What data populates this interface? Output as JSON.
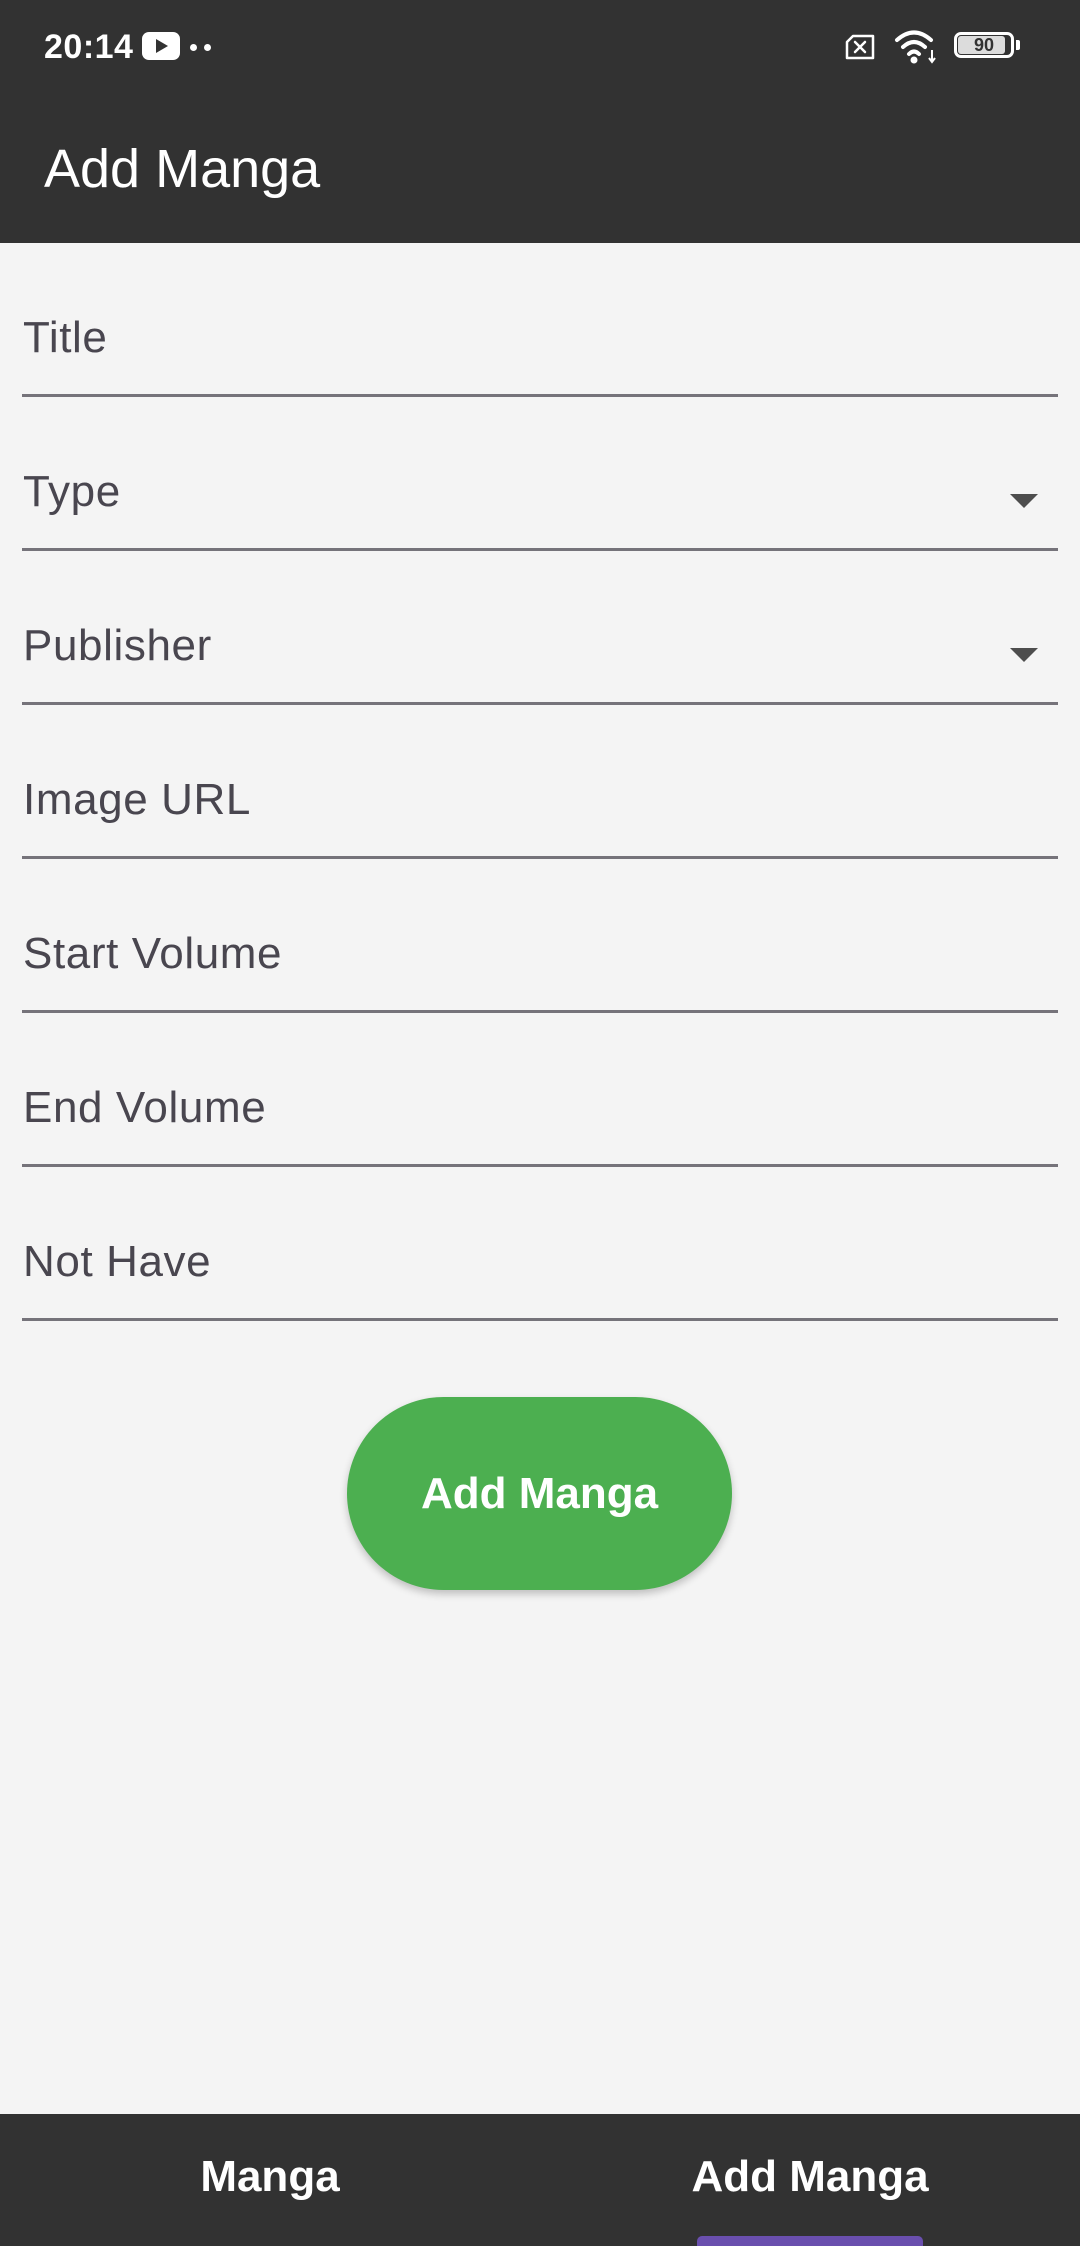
{
  "status_bar": {
    "time": "20:14",
    "battery_level": "90",
    "battery_fraction": 0.9
  },
  "app_bar": {
    "title": "Add Manga"
  },
  "form": {
    "fields": [
      {
        "label": "Title",
        "type": "text",
        "value": ""
      },
      {
        "label": "Type",
        "type": "dropdown",
        "value": ""
      },
      {
        "label": "Publisher",
        "type": "dropdown",
        "value": ""
      },
      {
        "label": "Image URL",
        "type": "text",
        "value": ""
      },
      {
        "label": "Start Volume",
        "type": "text",
        "value": ""
      },
      {
        "label": "End Volume",
        "type": "text",
        "value": ""
      },
      {
        "label": "Not Have",
        "type": "text",
        "value": ""
      }
    ],
    "submit_label": "Add Manga"
  },
  "bottom_nav": {
    "tabs": [
      {
        "label": "Manga",
        "selected": false
      },
      {
        "label": "Add Manga",
        "selected": true
      }
    ]
  },
  "colors": {
    "bar_background": "#323232",
    "page_background": "#f4f4f4",
    "button_green": "#4caf50",
    "selected_indicator": "#6a4fae",
    "label_text": "#49464f",
    "underline": "#75737a"
  }
}
